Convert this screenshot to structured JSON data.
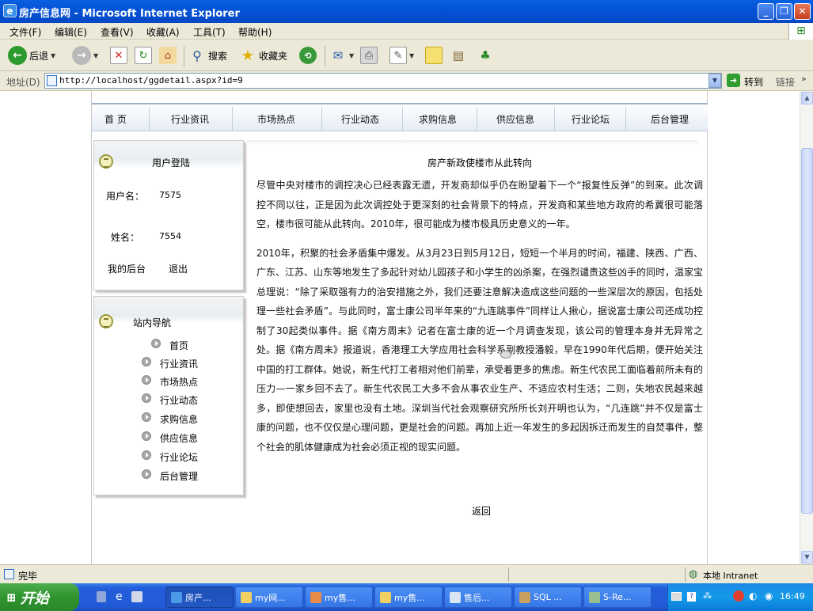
{
  "window": {
    "title": "房产信息网 - Microsoft Internet Explorer"
  },
  "menu": [
    "文件(F)",
    "编辑(E)",
    "查看(V)",
    "收藏(A)",
    "工具(T)",
    "帮助(H)"
  ],
  "toolbar": {
    "back": "后退",
    "search": "搜索",
    "favorites": "收藏夹"
  },
  "address": {
    "label": "地址(D)",
    "url": "http://localhost/ggdetail.aspx?id=9",
    "go": "转到",
    "links": "链接"
  },
  "nav": [
    "首 页",
    "行业资讯",
    "市场热点",
    "行业动态",
    "求购信息",
    "供应信息",
    "行业论坛",
    "后台管理"
  ],
  "login": {
    "title": "用户登陆",
    "user_label": "用户名：",
    "user_value": "7575",
    "name_label": "姓名：",
    "name_value": "7554",
    "mybackend": "我的后台",
    "logout": "退出"
  },
  "sitenav": {
    "title": "站内导航",
    "items": [
      "首页",
      "行业资讯",
      "市场热点",
      "行业动态",
      "求购信息",
      "供应信息",
      "行业论坛",
      "后台管理"
    ]
  },
  "article": {
    "title": "房产新政使楼市从此转向",
    "p1": "尽管中央对楼市的调控决心已经表露无遗，开发商却似乎仍在盼望着下一个“报复性反弹”的到来。此次调控不同以往，正是因为此次调控处于更深刻的社会背景下的特点，开发商和某些地方政府的希冀很可能落空，楼市很可能从此转向。2010年，很可能成为楼市极具历史意义的一年。",
    "p2": "2010年，积聚的社会矛盾集中爆发。从3月23日到5月12日，短短一个半月的时间，福建、陕西、广西、广东、江苏、山东等地发生了多起针对幼儿园孩子和小学生的凶杀案，在强烈谴责这些凶手的同时，温家宝总理说：“除了采取强有力的治安措施之外，我们还要注意解决造成这些问题的一些深层次的原因，包括处理一些社会矛盾”。与此同时，富士康公司半年来的“九连跳事件”同样让人揪心，据说富士康公司还成功控制了30起类似事件。据《南方周末》记者在富士康的近一个月调查发现，该公司的管理本身并无异常之处。据《南方周末》报道说，香港理工大学应用社会科学系副教授潘毅，早在1990年代后期，便开始关注中国的打工群体。她说，新生代打工者相对他们前辈，承受着更多的焦虑。新生代农民工面临着前所未有的压力—一家乡回不去了。新生代农民工大多不会从事农业生产、不适应农村生活；二则，失地农民越来越多，即使想回去，家里也没有土地。深圳当代社会观察研究所所长刘开明也认为，“几连跳”并不仅是富士康的问题，也不仅仅是心理问题，更是社会的问题。再加上近一年发生的多起因拆迁而发生的自焚事件，整个社会的肌体健康成为社会必须正视的现实问题。",
    "back": "返回"
  },
  "status": {
    "left": "完毕",
    "zone": "本地 Intranet"
  },
  "taskbar": {
    "start": "开始",
    "tasks": [
      "房产...",
      "my网...",
      "my售...",
      "my售...",
      "售后...",
      "SQL ...",
      "S-Re..."
    ],
    "time": "16:49"
  },
  "colors": {
    "title_blue": "#0454d8",
    "chrome": "#ece9d8",
    "taskbar_blue": "#245edb",
    "start_green": "#2f932f"
  }
}
